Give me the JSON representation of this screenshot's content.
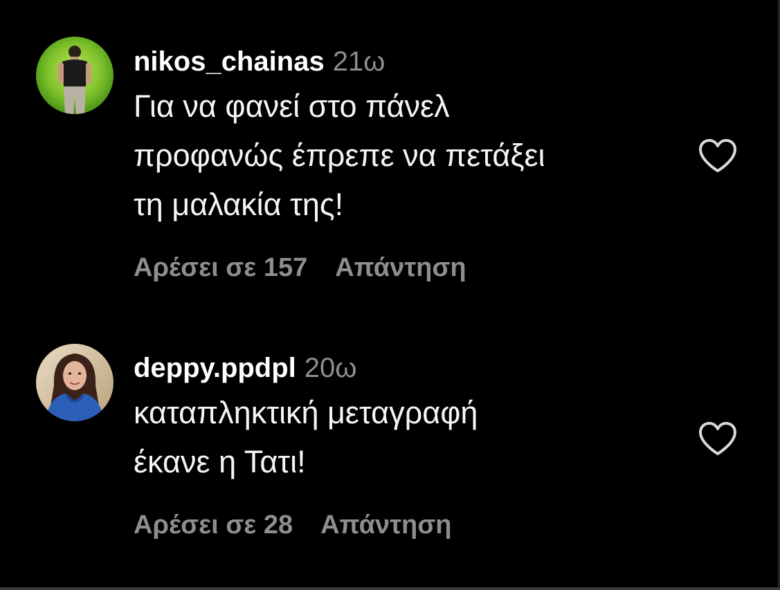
{
  "comments": [
    {
      "username": "nikos_chainas",
      "time": "21ω",
      "text_lines": [
        "Για να φανεί στο πάνελ",
        "προφανώς έπρεπε να πετάξει",
        "τη μαλακία της!"
      ],
      "likes_label": "Αρέσει σε 157",
      "reply_label": "Απάντηση",
      "avatar_icon": "profile-photo-man-icon",
      "like_icon": "heart-outline-icon"
    },
    {
      "username": "deppy.ppdpl",
      "time": "20ω",
      "text_lines": [
        "καταπληκτική μεταγραφή",
        "έκανε η Τατι!"
      ],
      "likes_label": "Αρέσει σε 28",
      "reply_label": "Απάντηση",
      "avatar_icon": "profile-photo-woman-icon",
      "like_icon": "heart-outline-icon"
    }
  ],
  "colors": {
    "background": "#000000",
    "primary_text": "#ffffff",
    "secondary_text": "#8e8e8e"
  }
}
